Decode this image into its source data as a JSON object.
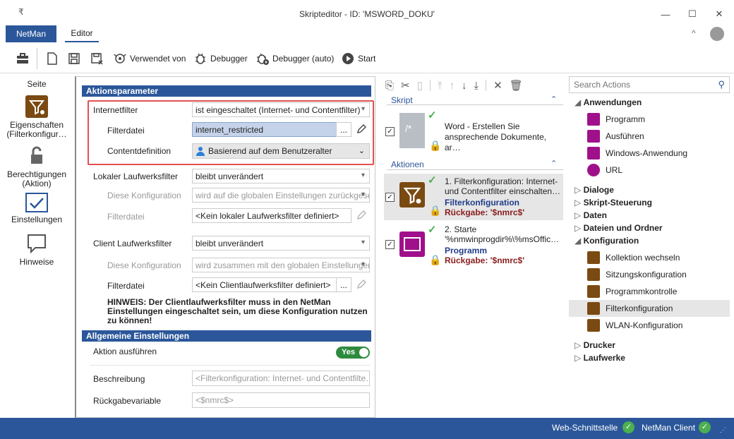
{
  "window": {
    "title": "Skripteditor - ID: 'MSWORD_DOKU'",
    "menu_glyph": "₹"
  },
  "tabs": {
    "netman": "NetMan",
    "editor": "Editor"
  },
  "toolbar": {
    "used_by": "Verwendet von",
    "debugger": "Debugger",
    "debugger_auto": "Debugger (auto)",
    "start": "Start"
  },
  "leftnav": {
    "header": "Seite",
    "items": [
      {
        "label": "Eigenschaften (Filterkonfigur…",
        "icon": "filter-gear-icon"
      },
      {
        "label": "Berechtigungen (Aktion)",
        "icon": "lock-icon"
      },
      {
        "label": "Einstellungen",
        "icon": "checkmark-icon"
      },
      {
        "label": "Hinweise",
        "icon": "speech-bubble-icon"
      }
    ]
  },
  "params": {
    "section_title": "Aktionsparameter",
    "internetfilter_label": "Internetfilter",
    "internetfilter_value": "ist eingeschaltet (Internet- und Contentfilter)",
    "filterdatei_label": "Filterdatei",
    "filterdatei_value": "internet_restricted",
    "contentdef_label": "Contentdefinition",
    "contentdef_value": "Basierend auf dem Benutzeralter",
    "local_label": "Lokaler Laufwerksfilter",
    "local_value": "bleibt unverändert",
    "local_config_label": "Diese Konfiguration",
    "local_config_value": "wird auf die globalen Einstellungen zurückgesetz",
    "local_file_label": "Filterdatei",
    "local_file_value": "<Kein lokaler Laufwerksfilter definiert>",
    "client_label": "Client Laufwerksfilter",
    "client_value": "bleibt unverändert",
    "client_config_label": "Diese Konfiguration",
    "client_config_value": "wird zusammen mit den globalen Einstellungen ve",
    "client_file_label": "Filterdatei",
    "client_file_value": "<Kein Clientlaufwerksfilter definiert>",
    "hint": "HINWEIS: Der Clientlaufwerksfilter muss in den NetMan Einstellungen eingeschaltet sein, um diese Konfiguration nutzen zu können!",
    "browse": "..."
  },
  "general": {
    "section_title": "Allgemeine Einstellungen",
    "execute_label": "Aktion ausführen",
    "execute_value": "Yes",
    "desc_label": "Beschreibung",
    "desc_value": "<Filterkonfiguration: Internet- und Contentfilte…",
    "ret_label": "Rückgabevariable",
    "ret_value": "<$nmrc$>"
  },
  "script": {
    "skript_header": "Skript",
    "word_title": "Word - Erstellen Sie ansprechende Dokumente, ar…",
    "aktionen_header": "Aktionen",
    "action1_title": "1. Filterkonfiguration: Internet- und Contentfilter einschalten…",
    "action1_type": "Filterkonfiguration",
    "action1_ret": "Rückgabe: '$nmrc$'",
    "action2_title": "2. Starte '%nmwinprogdir%\\%msOffic…",
    "action2_type": "Programm",
    "action2_ret": "Rückgabe: '$nmrc$'"
  },
  "actions": {
    "search_placeholder": "Search Actions",
    "groups": {
      "anwendungen": "Anwendungen",
      "dialoge": "Dialoge",
      "skript": "Skript-Steuerung",
      "daten": "Daten",
      "dateien": "Dateien und Ordner",
      "konfiguration": "Konfiguration",
      "drucker": "Drucker",
      "laufwerke": "Laufwerke"
    },
    "anw_items": [
      "Programm",
      "Ausführen",
      "Windows-Anwendung",
      "URL"
    ],
    "konf_items": [
      "Kollektion wechseln",
      "Sitzungskonfiguration",
      "Programmkontrolle",
      "Filterkonfiguration",
      "WLAN-Konfiguration"
    ]
  },
  "status": {
    "web": "Web-Schnittstelle",
    "client": "NetMan Client"
  },
  "colors": {
    "accent": "#2b579a",
    "highlight": "#e05050",
    "filter_brown": "#7a4a12",
    "program_magenta": "#a0108a"
  }
}
